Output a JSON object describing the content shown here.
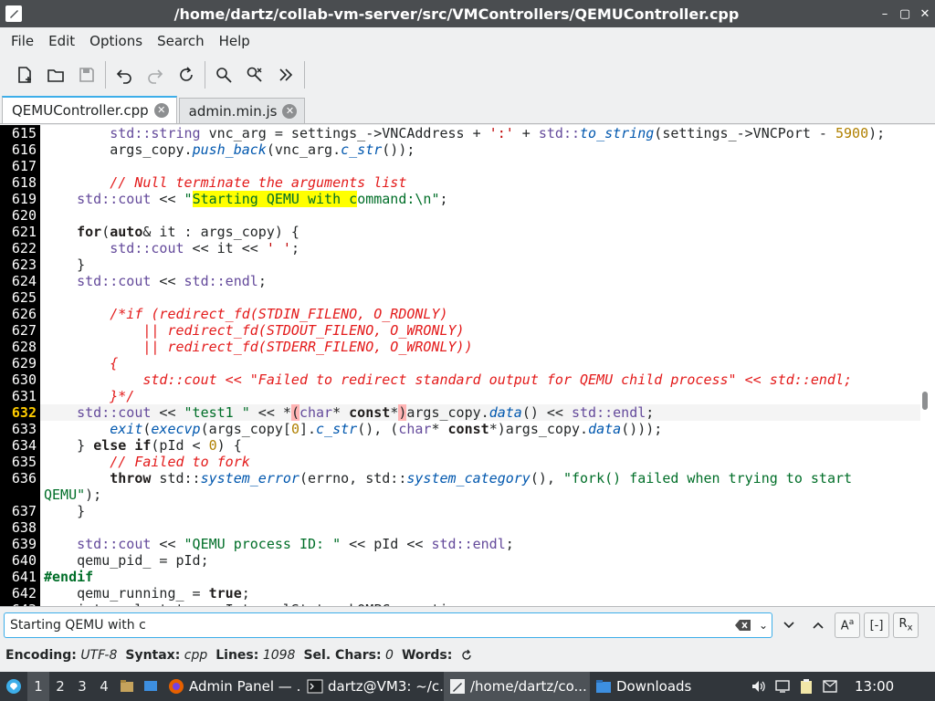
{
  "window": {
    "title": "/home/dartz/collab-vm-server/src/VMControllers/QEMUController.cpp",
    "buttons": [
      "–",
      "▢",
      "✕"
    ]
  },
  "menu": [
    "File",
    "Edit",
    "Options",
    "Search",
    "Help"
  ],
  "tabs": [
    {
      "label": "QEMUController.cpp",
      "active": true
    },
    {
      "label": "admin.min.js",
      "active": false
    }
  ],
  "search": {
    "value": "Starting QEMU with c"
  },
  "status": {
    "encoding_label": "Encoding:",
    "encoding": "UTF-8",
    "syntax_label": "Syntax:",
    "syntax": "cpp",
    "lines_label": "Lines:",
    "lines": "1098",
    "sel_label": "Sel. Chars:",
    "sel": "0",
    "words_label": "Words:"
  },
  "taskbar": {
    "workspaces": [
      "1",
      "2",
      "3",
      "4"
    ],
    "tasks": [
      "Admin Panel — ...",
      "dartz@VM3: ~/c...",
      "/home/dartz/co...",
      "Downloads"
    ],
    "clock": "13:00"
  },
  "colors": {
    "accent": "#3daee9",
    "gutter": "#000000",
    "match_highlight": "#ffff00",
    "bracket_highlight": "#ffb4b4"
  }
}
